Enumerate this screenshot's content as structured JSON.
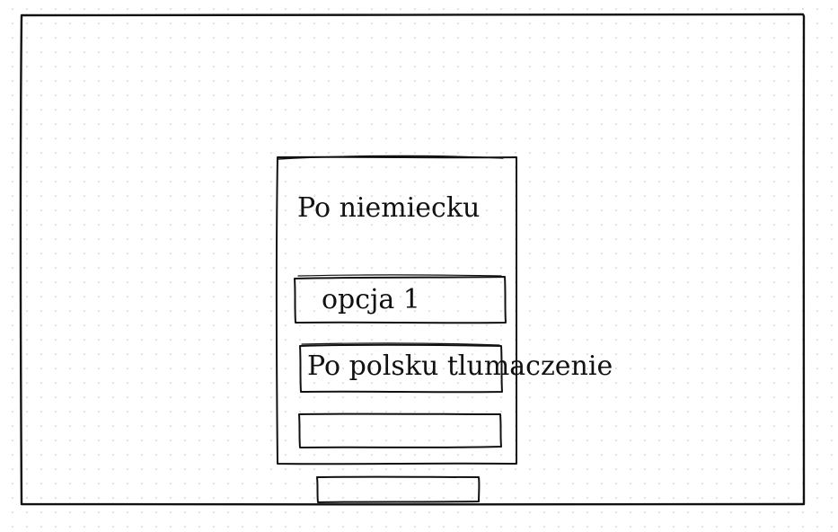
{
  "card": {
    "title": "Po niemiecku"
  },
  "options": [
    {
      "label": "opcja 1"
    },
    {
      "label": "Po polsku tlumaczenie"
    },
    {
      "label": ""
    }
  ],
  "action_button": {
    "label": ""
  }
}
